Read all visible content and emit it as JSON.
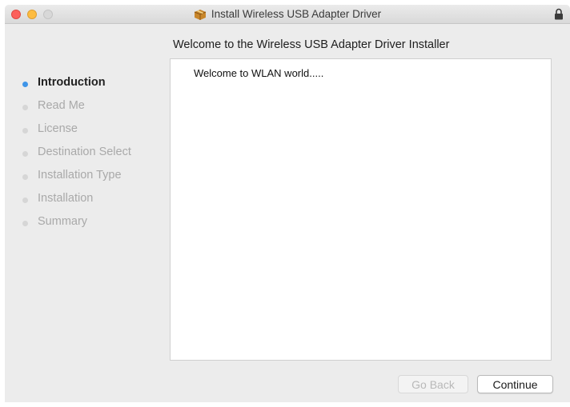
{
  "window": {
    "title": "Install Wireless USB Adapter Driver"
  },
  "heading": "Welcome to the Wireless USB Adapter Driver Installer",
  "content": {
    "text": "Welcome to WLAN world....."
  },
  "steps": [
    {
      "label": "Introduction",
      "active": true
    },
    {
      "label": "Read Me",
      "active": false
    },
    {
      "label": "License",
      "active": false
    },
    {
      "label": "Destination Select",
      "active": false
    },
    {
      "label": "Installation Type",
      "active": false
    },
    {
      "label": "Installation",
      "active": false
    },
    {
      "label": "Summary",
      "active": false
    }
  ],
  "buttons": {
    "back_label": "Go Back",
    "continue_label": "Continue"
  },
  "colors": {
    "active_step_dot": "#3f95e8",
    "inactive_step_text": "#a9a9a9"
  },
  "icons": {
    "title_icon": "package-icon",
    "lock_icon": "lock-icon"
  }
}
